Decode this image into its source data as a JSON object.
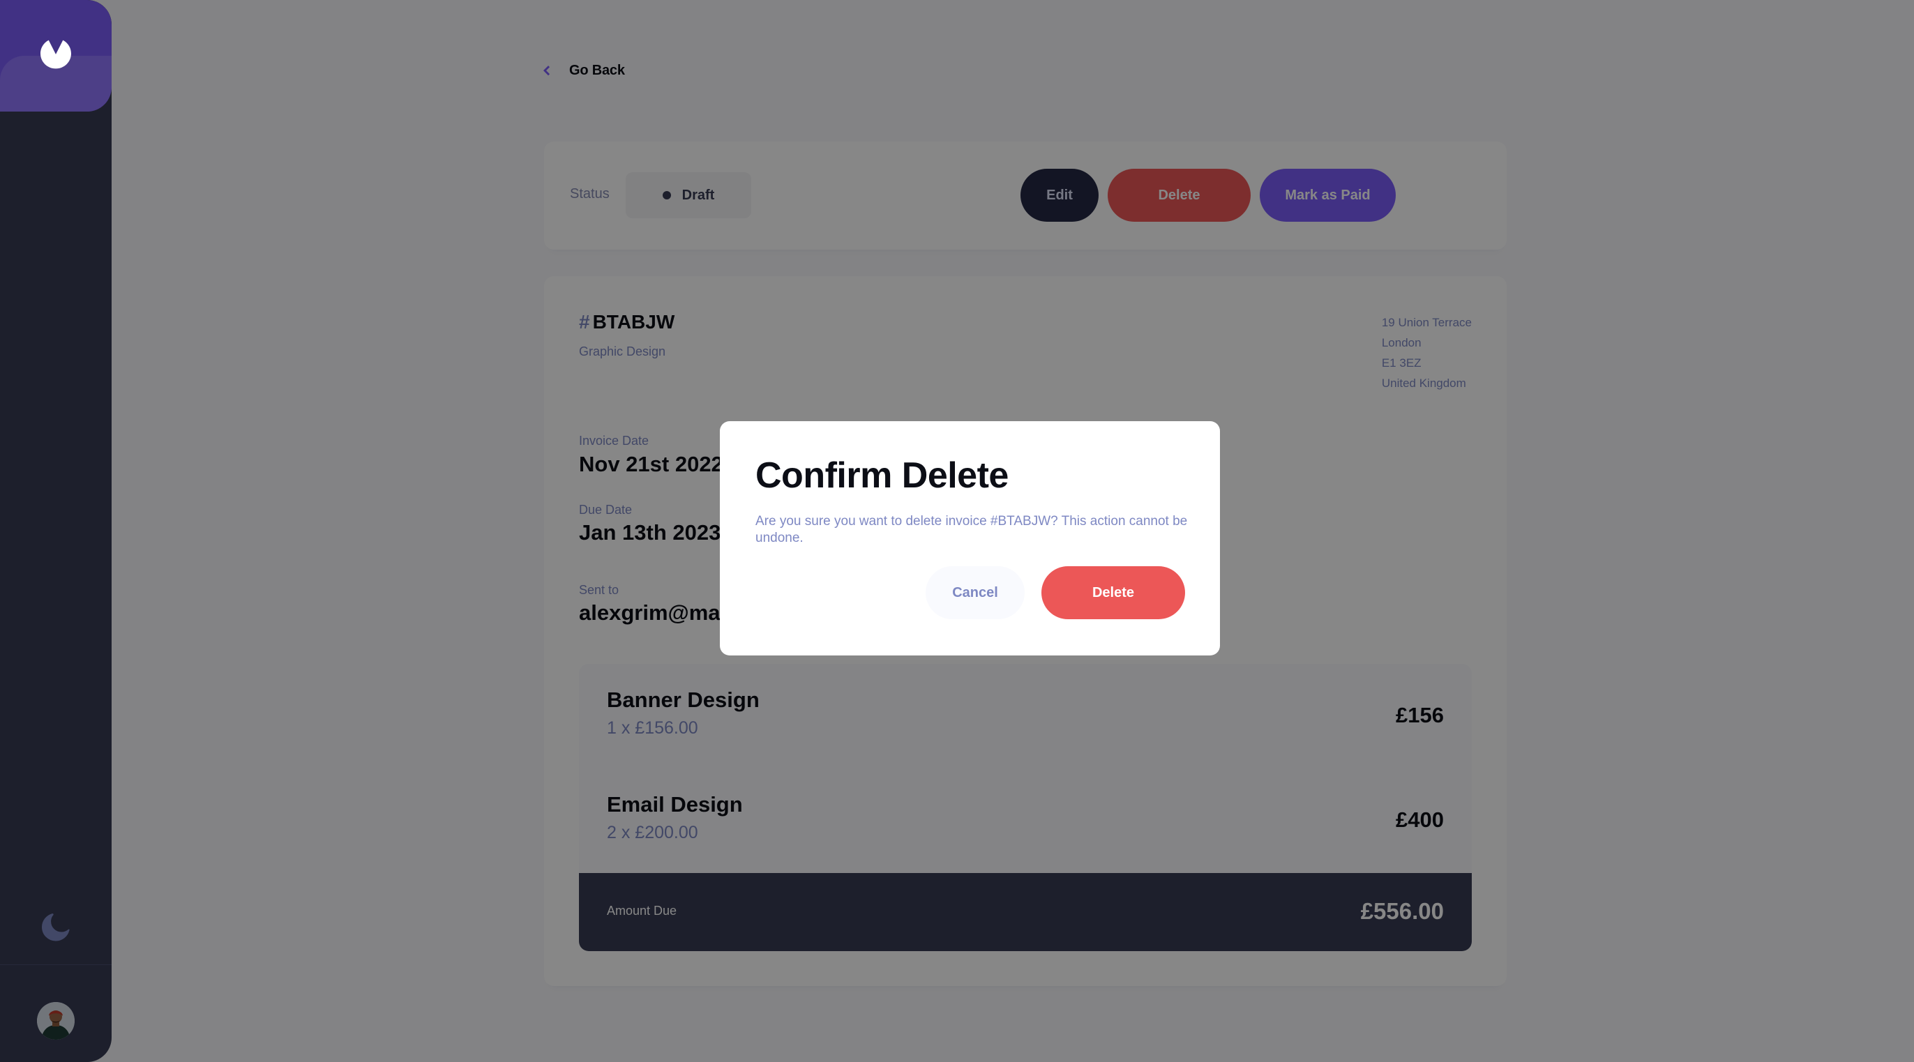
{
  "colors": {
    "accent": "#7c5dfa",
    "accent_light": "#9277ff",
    "danger": "#ec5757",
    "sidebar": "#373b53",
    "muted_text": "#7e88c3"
  },
  "sidebar": {
    "logo_icon": "logo-icon",
    "theme_icon": "moon-icon",
    "avatar_icon": "user-avatar"
  },
  "nav": {
    "back_icon": "chevron-left-icon",
    "back_label": "Go Back"
  },
  "status_bar": {
    "status_label": "Status",
    "status_value": "Draft",
    "edit_label": "Edit",
    "delete_label": "Delete",
    "mark_paid_label": "Mark as Paid"
  },
  "invoice": {
    "hash": "#",
    "id": "BTABJW",
    "description": "Graphic Design",
    "sender_address": [
      "19 Union Terrace",
      "London",
      "E1 3EZ",
      "United Kingdom"
    ],
    "invoice_date_label": "Invoice Date",
    "invoice_date": "Nov 21st 2022",
    "due_date_label": "Due Date",
    "due_date": "Jan 13th 2023",
    "sent_to_label": "Sent to",
    "sent_to": "alexgrim@mail.com",
    "items": [
      {
        "name": "Banner Design",
        "qty_price": "1 x £156.00",
        "total": "£156"
      },
      {
        "name": "Email Design",
        "qty_price": "2 x £200.00",
        "total": "£400"
      }
    ],
    "amount_due_label": "Amount Due",
    "amount_due": "£556.00"
  },
  "modal": {
    "title": "Confirm Delete",
    "message": "Are you sure you want to delete invoice #BTABJW? This action cannot be undone.",
    "cancel_label": "Cancel",
    "delete_label": "Delete"
  }
}
